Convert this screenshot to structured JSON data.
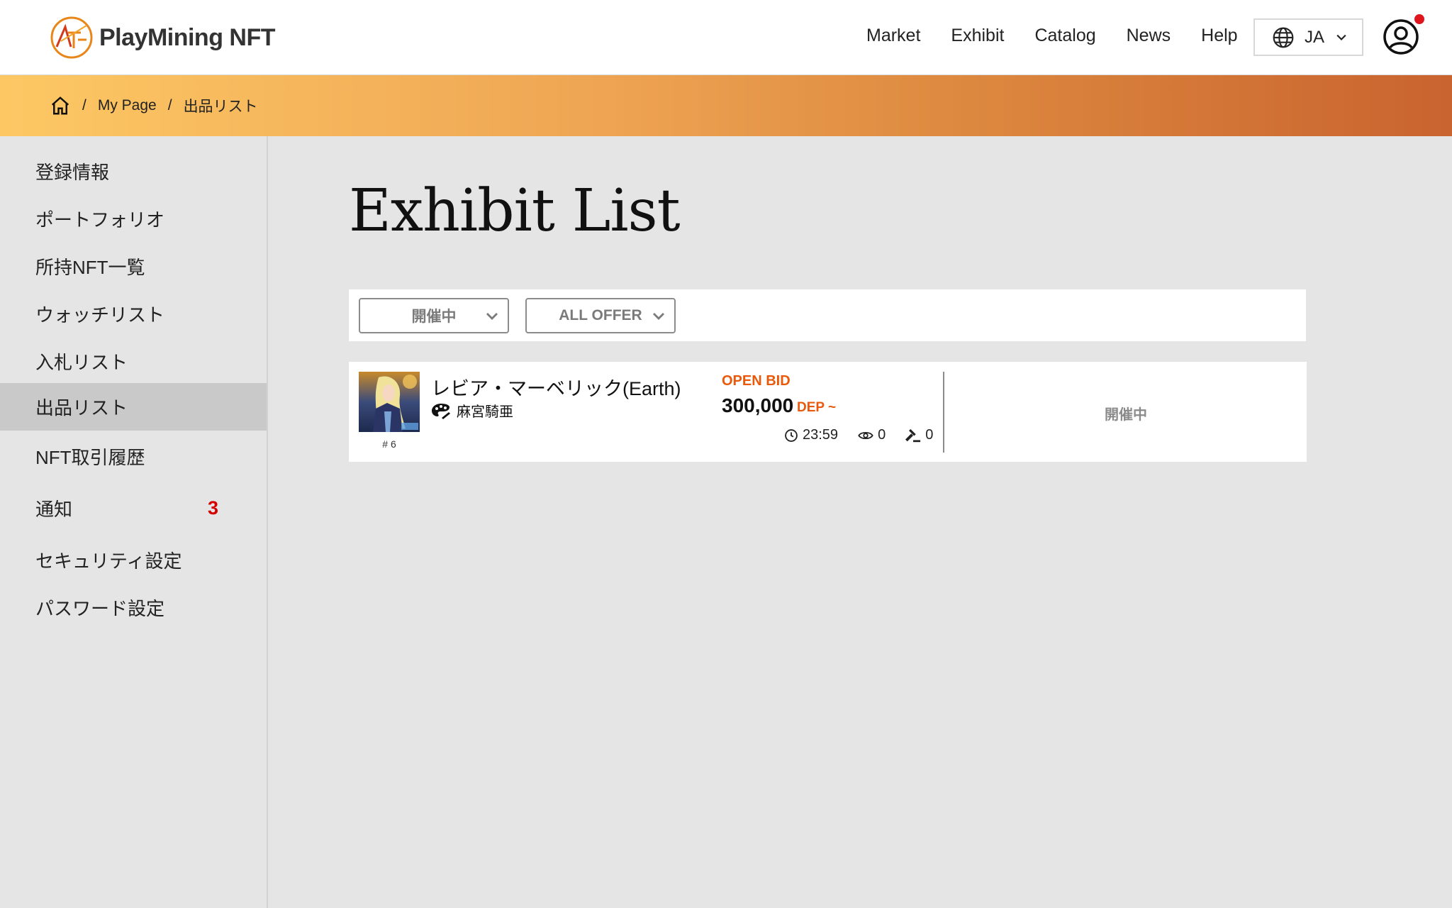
{
  "header": {
    "brand": "PlayMining NFT",
    "nav": [
      {
        "label": "Market"
      },
      {
        "label": "Exhibit"
      },
      {
        "label": "Catalog"
      },
      {
        "label": "News"
      },
      {
        "label": "Help"
      }
    ],
    "language": "JA",
    "notification_dot_color": "#e0141c"
  },
  "breadcrumb": {
    "items": [
      "My Page",
      "出品リスト"
    ],
    "separator": "/"
  },
  "sidebar": {
    "items": [
      {
        "label": "登録情報"
      },
      {
        "label": "ポートフォリオ"
      },
      {
        "label": "所持NFT一覧"
      },
      {
        "label": "ウォッチリスト"
      },
      {
        "label": "入札リスト"
      },
      {
        "label": "出品リスト",
        "active": true
      },
      {
        "label": "NFT取引履歴"
      },
      {
        "label": "通知",
        "badge": "3"
      },
      {
        "label": "セキュリティ設定"
      },
      {
        "label": "パスワード設定"
      }
    ]
  },
  "main": {
    "title": "Exhibit List",
    "filters": {
      "status": "開催中",
      "offer": "ALL OFFER"
    },
    "listings": [
      {
        "token_no": "# 6",
        "name": "レビア・マーベリック(Earth)",
        "creator": "麻宮騎亜",
        "bid_type": "OPEN BID",
        "price": "300,000",
        "price_unit": "DEP ~",
        "time_left": "23:59",
        "views": "0",
        "bids": "0",
        "status": "開催中"
      }
    ]
  },
  "colors": {
    "accent": "#e8590c",
    "band_start": "#fdc864",
    "band_end": "#c9632f",
    "badge": "#d40000"
  }
}
